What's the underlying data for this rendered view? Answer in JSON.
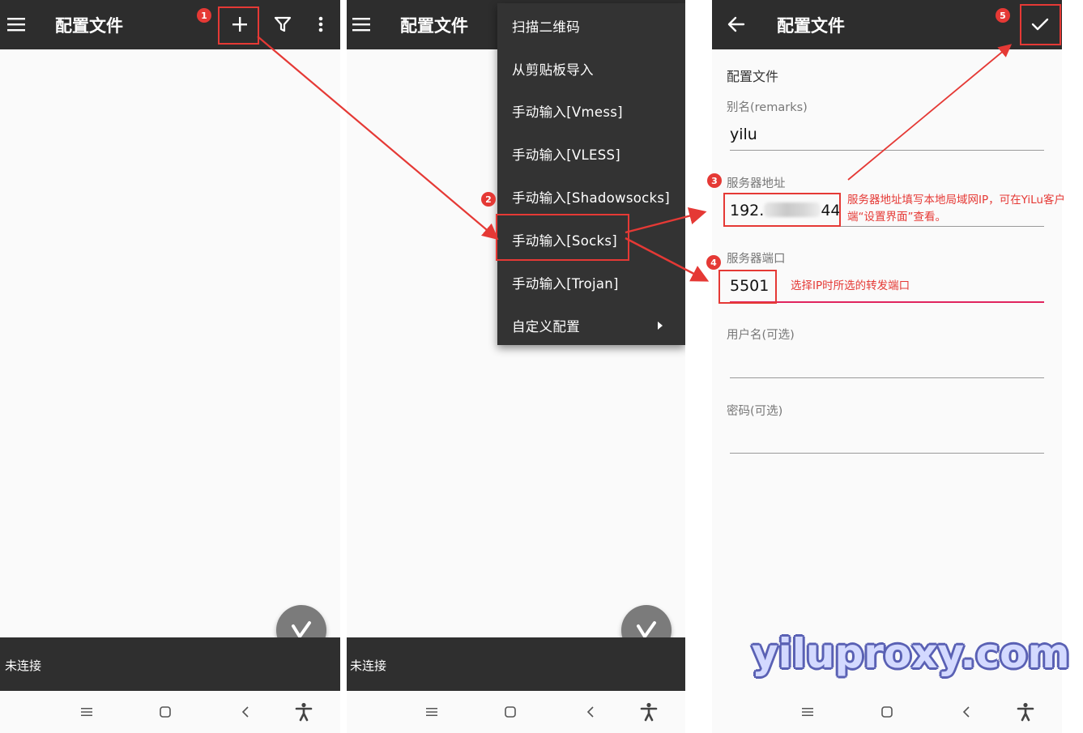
{
  "colors": {
    "appbar": "#2d2d2d",
    "status_bar": "#2f2f2f",
    "annotation": "#e53935",
    "active_underline": "#e0245e",
    "fab": "#7b7b7b"
  },
  "panel1": {
    "title": "配置文件",
    "icons": [
      "menu-icon",
      "plus-icon",
      "filter-icon",
      "more-vert-icon"
    ],
    "status": "未连接"
  },
  "panel2": {
    "title": "配置文件",
    "status": "未连接",
    "menu": [
      "扫描二维码",
      "从剪贴板导入",
      "手动输入[Vmess]",
      "手动输入[VLESS]",
      "手动输入[Shadowsocks]",
      "手动输入[Socks]",
      "手动输入[Trojan]",
      "自定义配置"
    ]
  },
  "panel3": {
    "title": "配置文件",
    "section": "配置文件",
    "fields": {
      "remarks_label": "别名(remarks)",
      "remarks_value": "yilu",
      "server_label": "服务器地址",
      "server_value_prefix": "192.",
      "server_value_suffix": "44",
      "port_label": "服务器端口",
      "port_value": "5501",
      "username_label": "用户名(可选)",
      "password_label": "密码(可选)"
    }
  },
  "annotations": {
    "steps": [
      "1",
      "2",
      "3",
      "4",
      "5"
    ],
    "note_server": "服务器地址填写本地局域网IP，可在YiLu客户端“设置界面”查看。",
    "note_port": "选择IP时所选的转发端口"
  },
  "watermark": "yiluproxy.com"
}
